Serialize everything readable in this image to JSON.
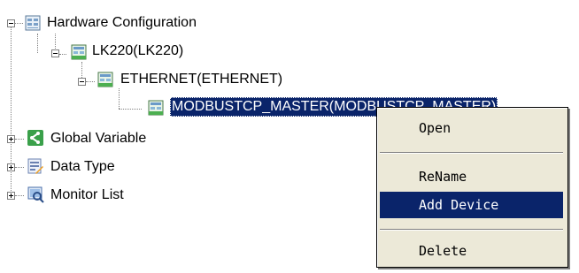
{
  "tree": {
    "root": {
      "label": "Hardware Configuration",
      "icon": "hardware-config-icon"
    },
    "controller": {
      "label": "LK220(LK220)",
      "icon": "controller-module-icon"
    },
    "ethernet": {
      "label": "ETHERNET(ETHERNET)",
      "icon": "ethernet-module-icon"
    },
    "device": {
      "label": "MODBUSTCP_MASTER(MODBUSTCP_MASTER)",
      "icon": "device-module-icon"
    },
    "global_variable": {
      "label": "Global Variable",
      "icon": "share-icon"
    },
    "data_type": {
      "label": "Data Type",
      "icon": "data-type-icon"
    },
    "monitor_list": {
      "label": "Monitor List",
      "icon": "monitor-icon"
    }
  },
  "context_menu": {
    "items": [
      "Open",
      "ReName",
      "Add Device",
      "Delete"
    ],
    "highlighted": "Add Device"
  },
  "colors": {
    "selection": "#0a246a",
    "menu_bg": "#ece9d8",
    "module_green": "#4caf50"
  }
}
